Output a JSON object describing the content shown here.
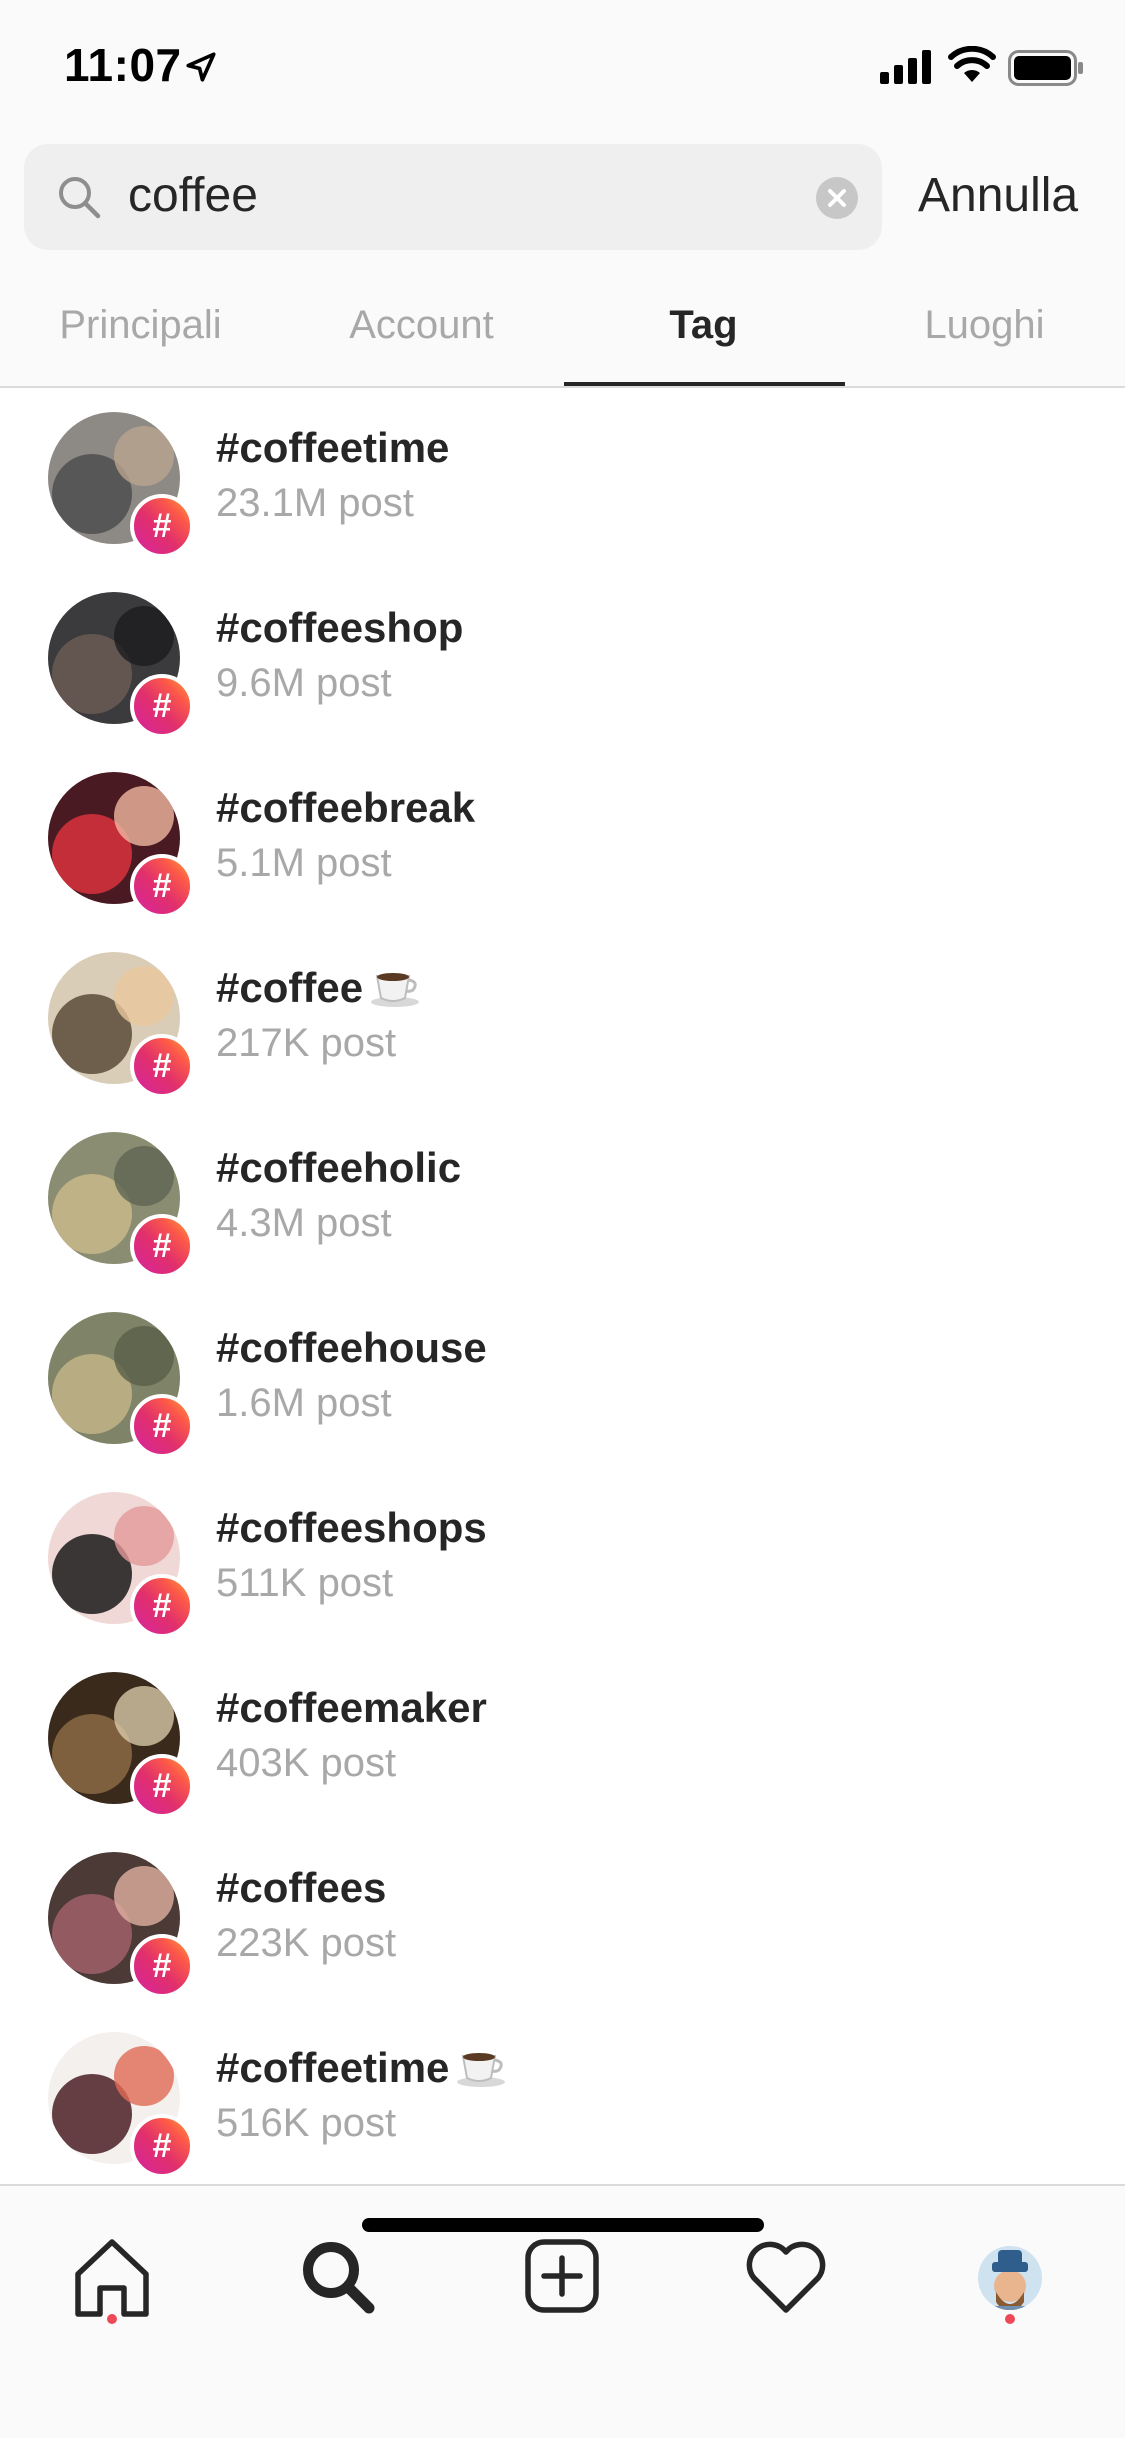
{
  "status_bar": {
    "time": "11:07"
  },
  "search": {
    "value": "coffee",
    "cancel_label": "Annulla"
  },
  "tabs": [
    {
      "label": "Principali",
      "active": false
    },
    {
      "label": "Account",
      "active": false
    },
    {
      "label": "Tag",
      "active": true
    },
    {
      "label": "Luoghi",
      "active": false
    }
  ],
  "results": [
    {
      "tag": "#coffeetime",
      "posts": "23.1M post",
      "emoji": false
    },
    {
      "tag": "#coffeeshop",
      "posts": "9.6M post",
      "emoji": false
    },
    {
      "tag": "#coffeebreak",
      "posts": "5.1M post",
      "emoji": false
    },
    {
      "tag": "#coffee",
      "posts": "217K post",
      "emoji": true
    },
    {
      "tag": "#coffeeholic",
      "posts": "4.3M post",
      "emoji": false
    },
    {
      "tag": "#coffeehouse",
      "posts": "1.6M post",
      "emoji": false
    },
    {
      "tag": "#coffeeshops",
      "posts": "511K post",
      "emoji": false
    },
    {
      "tag": "#coffeemaker",
      "posts": "403K post",
      "emoji": false
    },
    {
      "tag": "#coffees",
      "posts": "223K post",
      "emoji": false
    },
    {
      "tag": "#coffeetime",
      "posts": "516K post",
      "emoji": true
    }
  ],
  "badge_symbol": "#",
  "colors": {
    "accent_dot": "#ed4956",
    "secondary_text": "#a8a8a8",
    "primary_text": "#262626"
  },
  "nav": {
    "items": [
      "home-icon",
      "search-icon",
      "new-post-icon",
      "activity-heart-icon",
      "profile-avatar"
    ]
  }
}
